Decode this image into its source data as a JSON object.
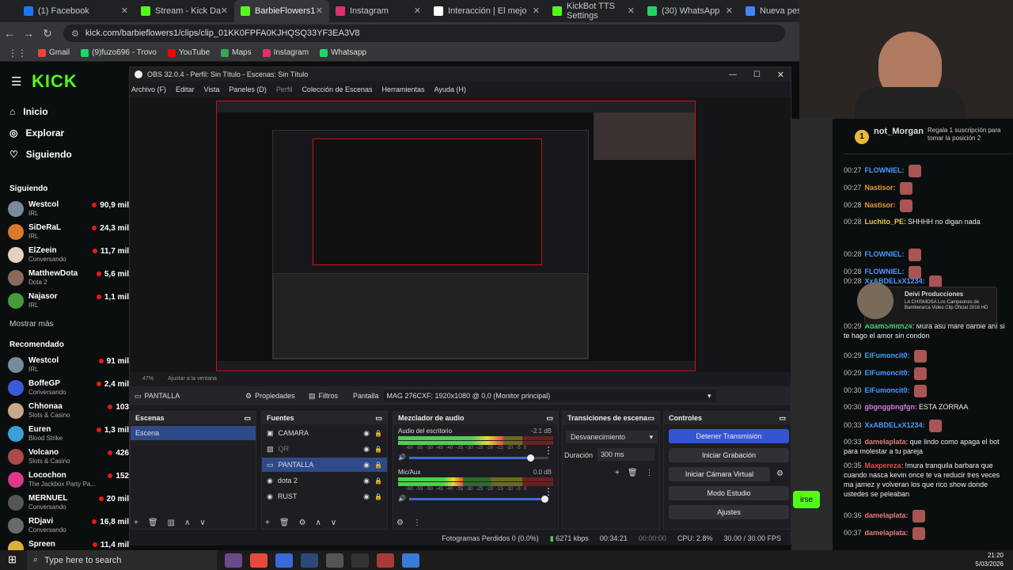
{
  "browser": {
    "tabs": [
      {
        "label": "(1) Facebook",
        "color": "#1877f2"
      },
      {
        "label": "Stream - Kick Da",
        "color": "#53fc18"
      },
      {
        "label": "BarbieFlowers1",
        "color": "#53fc18"
      },
      {
        "label": "Instagram",
        "color": "#e1306c"
      },
      {
        "label": "Interacción | El mejo",
        "color": "#ffffff"
      },
      {
        "label": "KickBot TTS Settings",
        "color": "#53fc18"
      },
      {
        "label": "(30) WhatsApp",
        "color": "#25d366"
      },
      {
        "label": "Nueva pestaña",
        "color": "#4285f4"
      }
    ],
    "url": "kick.com/barbieflowers1/clips/clip_01KK0FPFA0KJHQSQ33YF3EA3V8",
    "bookmarks": [
      {
        "label": "Gmail",
        "color": "#ea4335"
      },
      {
        "label": "(9)fuzo696 - Trovo",
        "color": "#19d66b"
      },
      {
        "label": "YouTube",
        "color": "#ff0000"
      },
      {
        "label": "Maps",
        "color": "#34a853"
      },
      {
        "label": "Instagram",
        "color": "#e1306c"
      },
      {
        "label": "Whatsapp",
        "color": "#25d366"
      }
    ]
  },
  "kick": {
    "logo": "KICK",
    "nav": [
      {
        "label": "Inicio",
        "icon": "home-icon"
      },
      {
        "label": "Explorar",
        "icon": "compass-icon"
      },
      {
        "label": "Siguiendo",
        "icon": "heart-icon"
      }
    ],
    "following_title": "Siguiendo",
    "following": [
      {
        "name": "Westcol",
        "cat": "IRL",
        "viewers": "90,9 mil",
        "color": "#7a8a9a"
      },
      {
        "name": "SiDeRaL",
        "cat": "IRL",
        "viewers": "24,3 mil",
        "color": "#d97a2a"
      },
      {
        "name": "ElZeein",
        "cat": "Conversando",
        "viewers": "11,7 mil",
        "color": "#e8d0c0"
      },
      {
        "name": "MatthewDota",
        "cat": "Dota 2",
        "viewers": "5,6 mil",
        "color": "#8a6a5a"
      },
      {
        "name": "Najasor",
        "cat": "IRL",
        "viewers": "1,1 mil",
        "color": "#4a9a3a"
      }
    ],
    "show_more": "Mostrar más",
    "recommended_title": "Recomendado",
    "recommended": [
      {
        "name": "Westcol",
        "cat": "IRL",
        "viewers": "91 mil",
        "color": "#7a8a9a"
      },
      {
        "name": "BoffeGP",
        "cat": "Conversando",
        "viewers": "2,4 mil",
        "color": "#3a5ad9"
      },
      {
        "name": "Chhonaa",
        "cat": "Slots & Casino",
        "viewers": "103",
        "color": "#c9a88a"
      },
      {
        "name": "Euren",
        "cat": "Blood Strike",
        "viewers": "1,3 mil",
        "color": "#3aa0d9"
      },
      {
        "name": "Volcano",
        "cat": "Slots & Casino",
        "viewers": "426",
        "color": "#aa4a4a"
      },
      {
        "name": "Locochon",
        "cat": "The Jackbox Party Pa...",
        "viewers": "152",
        "color": "#d93a8a"
      },
      {
        "name": "MERNUEL",
        "cat": "Conversando",
        "viewers": "20 mil",
        "color": "#555555"
      },
      {
        "name": "RDjavi",
        "cat": "Conversando",
        "viewers": "16,8 mil",
        "color": "#6a6a6a"
      },
      {
        "name": "Spreen",
        "cat": "",
        "viewers": "11,4 mil",
        "color": "#d9b03a"
      }
    ]
  },
  "obs": {
    "title": "OBS 32.0.4 - Perfil: Sin Título - Escenas: Sin Título",
    "menu": [
      "Archivo (F)",
      "Editar",
      "Vista",
      "Paneles (D)",
      "Perfil",
      "Colección de Escenas",
      "Herramientas",
      "Ayuda (H)"
    ],
    "zoom": "47%",
    "fit": "Ajustar a la ventana",
    "source_bar": {
      "name": "PANTALLA",
      "props": "Propiedades",
      "filters": "Filtros",
      "label": "Pantalla",
      "value": "MAG 276CXF: 1920x1080 @ 0,0 (Monitor principal)"
    },
    "scenes": {
      "title": "Escenas",
      "items": [
        "Escena"
      ]
    },
    "sources": {
      "title": "Fuentes",
      "items": [
        {
          "label": "CAMARA",
          "icon": "camera-icon"
        },
        {
          "label": "QR",
          "icon": "image-icon"
        },
        {
          "label": "PANTALLA",
          "icon": "monitor-icon"
        },
        {
          "label": "dota 2",
          "icon": "gamepad-icon"
        },
        {
          "label": "RUST",
          "icon": "gamepad-icon"
        }
      ]
    },
    "mixer": {
      "title": "Mezclador de audio",
      "channels": [
        {
          "label": "Audio del escritorio",
          "db": "-2.1 dB",
          "level": 0.68,
          "volume": 0.9
        },
        {
          "label": "Mic/Aux",
          "db": "0.0 dB",
          "level": 0.42,
          "volume": 1.0
        }
      ],
      "scale": [
        "-60",
        "-55",
        "-50",
        "-45",
        "-40",
        "-35",
        "-30",
        "-25",
        "-20",
        "-15",
        "-10",
        "-5",
        "0"
      ]
    },
    "transitions": {
      "title": "Transiciones de escena",
      "selected": "Desvanecimiento",
      "duration_label": "Duración",
      "duration": "300 ms"
    },
    "controls": {
      "title": "Controles",
      "buttons": [
        "Detener Transmisión",
        "Iniciar Grabación",
        "Iniciar Cámara Virtual",
        "Modo Estudio",
        "Ajustes"
      ]
    },
    "status": {
      "dropped": "Fotogramas Perdidos 0 (0.0%)",
      "kbps": "6271 kbps",
      "live": "00:34:21",
      "rec": "00:00:00",
      "cpu": "CPU: 2.8%",
      "fps": "30.00 / 30.00 FPS"
    }
  },
  "chat": {
    "top_user": "not_Morgan",
    "top_count": "1",
    "gift_text": "Regala 1 suscripción para tomar la posición 2",
    "popup": {
      "title": "Deivi Producciones",
      "text": "LA CHISMOSA Los Campeones de Bamberarca Video Clip Oficial 2016 HD"
    },
    "messages": [
      {
        "time": "00:27",
        "user": "FLOWNIEL:",
        "text": "",
        "color": "#4a9aff",
        "emote": true
      },
      {
        "time": "00:27",
        "user": "Nastisor:",
        "text": "",
        "color": "#e89a3a",
        "emote": true
      },
      {
        "time": "00:28",
        "user": "Nastisor:",
        "text": "",
        "color": "#e89a3a",
        "emote": true
      },
      {
        "time": "00:28",
        "user": "Luchito_PE:",
        "text": "SHHHH no digan nada",
        "color": "#e8c83a",
        "emote": false
      },
      {
        "time": "00:28",
        "user": "FLOWNIEL:",
        "text": "",
        "color": "#4a9aff",
        "emote": true
      },
      {
        "time": "00:28",
        "user": "FLOWNIEL:",
        "text": "",
        "color": "#4a9aff",
        "emote": true
      },
      {
        "time": "00:28",
        "user": "XxABDELxX1234:",
        "text": "",
        "color": "#4a9aff",
        "emote": true
      },
      {
        "time": "00:29",
        "user": "AdamSmith24:",
        "text": "Mura asu mare barbie ahí si te hago el amor sin condon",
        "color": "#4ad97a",
        "emote": false
      },
      {
        "time": "00:29",
        "user": "ElFumoncit0:",
        "text": "",
        "color": "#4a9aff",
        "emote": true
      },
      {
        "time": "00:29",
        "user": "ElFumoncit0:",
        "text": "",
        "color": "#4a9aff",
        "emote": true
      },
      {
        "time": "00:30",
        "user": "ElFumoncit0:",
        "text": "",
        "color": "#4a9aff",
        "emote": true
      },
      {
        "time": "00:30",
        "user": "gbgnggbngfgn:",
        "text": "ESTA ZORRAA",
        "color": "#d97ad9",
        "emote": false
      },
      {
        "time": "00:33",
        "user": "XxABDELxX1234:",
        "text": "",
        "color": "#4a9aff",
        "emote": true
      },
      {
        "time": "00:33",
        "user": "damelaplata:",
        "text": "que lindo como apaga el bot para molestar a tu pareja",
        "color": "#e87a7a",
        "emote": false
      },
      {
        "time": "00:35",
        "user": "Maxpereza:",
        "text": "!mura tranquila barbara que cuando nasca kevin once te va reducir tres veces ma jamez y volveran los que rico show donde ustedes se peleaban",
        "color": "#e84a4a",
        "emote": false
      },
      {
        "time": "00:36",
        "user": "damelaplata:",
        "text": "",
        "color": "#e87a7a",
        "emote": true
      },
      {
        "time": "00:37",
        "user": "damelaplata:",
        "text": "",
        "color": "#e87a7a",
        "emote": true
      }
    ],
    "follow_btn": "irse"
  },
  "taskbar": {
    "search": "Type here to search",
    "time": "21:20",
    "date": "5/03/2026"
  }
}
